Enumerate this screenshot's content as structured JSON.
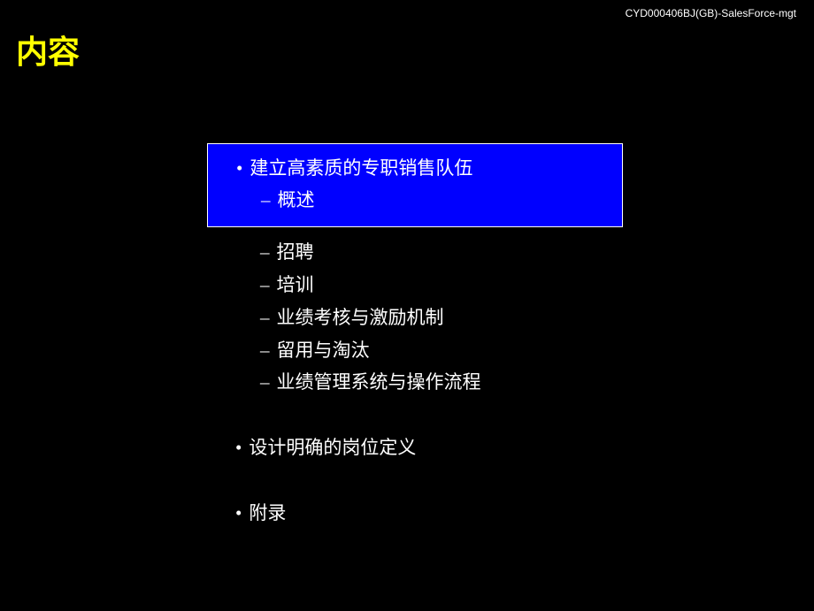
{
  "header": {
    "code": "CYD000406BJ(GB)-SalesForce-mgt"
  },
  "title": "内容",
  "sections": {
    "section1": {
      "main": "建立高素质的专职销售队伍",
      "highlighted_sub": "概述",
      "subs": [
        "招聘",
        "培训",
        "业绩考核与激励机制",
        "留用与淘汰",
        "业绩管理系统与操作流程"
      ]
    },
    "section2": {
      "main": "设计明确的岗位定义"
    },
    "section3": {
      "main": "附录"
    }
  }
}
